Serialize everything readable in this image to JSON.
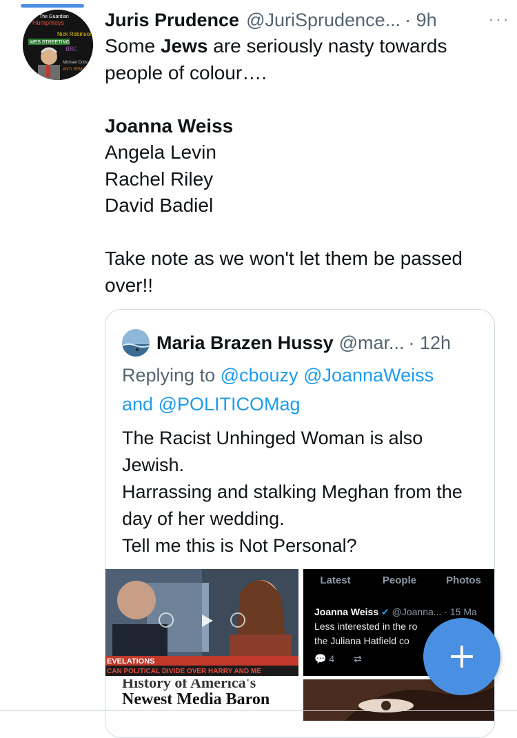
{
  "tweet": {
    "author_name": "Juris Prudence",
    "author_handle": "@JuriSprudence...",
    "time": "· 9h",
    "more_glyph": "···",
    "avatar_words": [
      "The Guardian",
      "Humphreys",
      "Nick Robinson",
      "WES STREETING",
      "BBC",
      "Michael Crick",
      "ANTI SEMITIS"
    ],
    "lines": {
      "l1_pre": "Some ",
      "l1_bold": "Jews",
      "l1_post": " are seriously nasty towards people of colour….",
      "name1": "Joanna Weiss",
      "name2": "Angela Levin",
      "name3": "Rachel Riley",
      "name4": "David Badiel",
      "closing": "Take note as we won't let them be passed over!!"
    }
  },
  "quoted_tweet": {
    "author_name": "Maria Brazen Hussy",
    "author_handle": "@mar...",
    "time": "· 12h",
    "replying_prefix": "Replying to ",
    "mention1": "@cbouzy",
    "mention2": "@JoannaWeiss",
    "and_word": "and",
    "mention3": "@POLITICOMag",
    "body": [
      "The Racist Unhinged Woman is also Jewish.",
      "Harrassing and stalking Meghan from the day of her wedding.",
      "Tell me this is Not Personal?"
    ]
  },
  "media": {
    "video_caption": "EVELATIONS",
    "video_ticker": "CAN POLITICAL DIVIDE OVER HARRY AND ME",
    "newspaper_top": "History of America's",
    "newspaper_caption": "Newest Media Baron",
    "screenshot": {
      "tabs": [
        "Latest",
        "People",
        "Photos"
      ],
      "embed_name": "Joanna Weiss",
      "embed_handle": "@Joanna...",
      "embed_time": "· 15 Ma",
      "embed_text_1": "Less interested in the ro",
      "embed_text_2": "the Juliana Hatfield co",
      "reply_count": "4"
    }
  },
  "fab": {
    "icon": "plus-icon"
  },
  "colors": {
    "accent": "#4a90e2",
    "link": "#1d9bf0",
    "muted": "#536471"
  }
}
